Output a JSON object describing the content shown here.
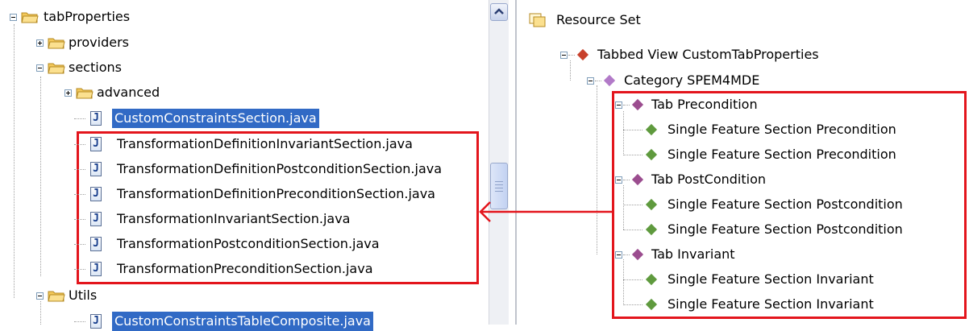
{
  "left_tree": {
    "tabProperties": "tabProperties",
    "providers": "providers",
    "sections": "sections",
    "advanced": "advanced",
    "custom_constraints_section": "CustomConstraintsSection.java",
    "files": [
      "TransformationDefinitionInvariantSection.java",
      "TransformationDefinitionPostconditionSection.java",
      "TransformationDefinitionPreconditionSection.java",
      "TransformationInvariantSection.java",
      "TransformationPostconditionSection.java",
      "TransformationPreconditionSection.java"
    ],
    "utils": "Utils",
    "custom_constraints_table": "CustomConstraintsTableComposite.java"
  },
  "right_tree": {
    "resource_set": "Resource Set",
    "tabbed_view": "Tabbed View CustomTabProperties",
    "category": "Category SPEM4MDE",
    "tabs": [
      {
        "label": "Tab Precondition",
        "sections": [
          "Single Feature Section Precondition",
          "Single Feature Section Precondition"
        ]
      },
      {
        "label": "Tab PostCondition",
        "sections": [
          "Single Feature Section Postcondition",
          "Single Feature Section Postcondition"
        ]
      },
      {
        "label": "Tab Invariant",
        "sections": [
          "Single Feature Section Invariant",
          "Single Feature Section Invariant"
        ]
      }
    ]
  },
  "colors": {
    "highlight_border": "#e3151c",
    "selection": "#316ac5",
    "folder": "#f3c85a",
    "diamond_green": "#5f9a3e",
    "diamond_purple": "#9b4d8f"
  },
  "icons": [
    "folder-icon",
    "java-file-icon",
    "diamond-icon",
    "resource-set-icon",
    "scroll-up-arrow-icon"
  ]
}
